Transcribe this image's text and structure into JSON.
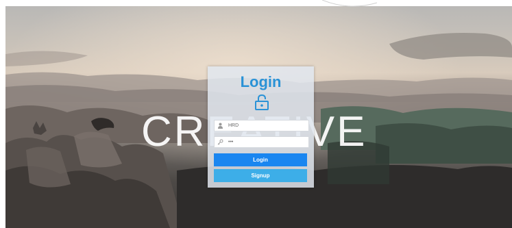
{
  "background": {
    "brand_text": "CREATIVE"
  },
  "login": {
    "title": "Login",
    "username_value": "HRD",
    "password_value": "•••",
    "login_label": "Login",
    "signup_label": "Signup"
  },
  "colors": {
    "title": "#2a92d6",
    "login_button": "#1a86f0",
    "signup_button": "#3daee8"
  },
  "icons": {
    "lock": "lock-icon",
    "user": "user-icon",
    "key": "key-icon"
  }
}
